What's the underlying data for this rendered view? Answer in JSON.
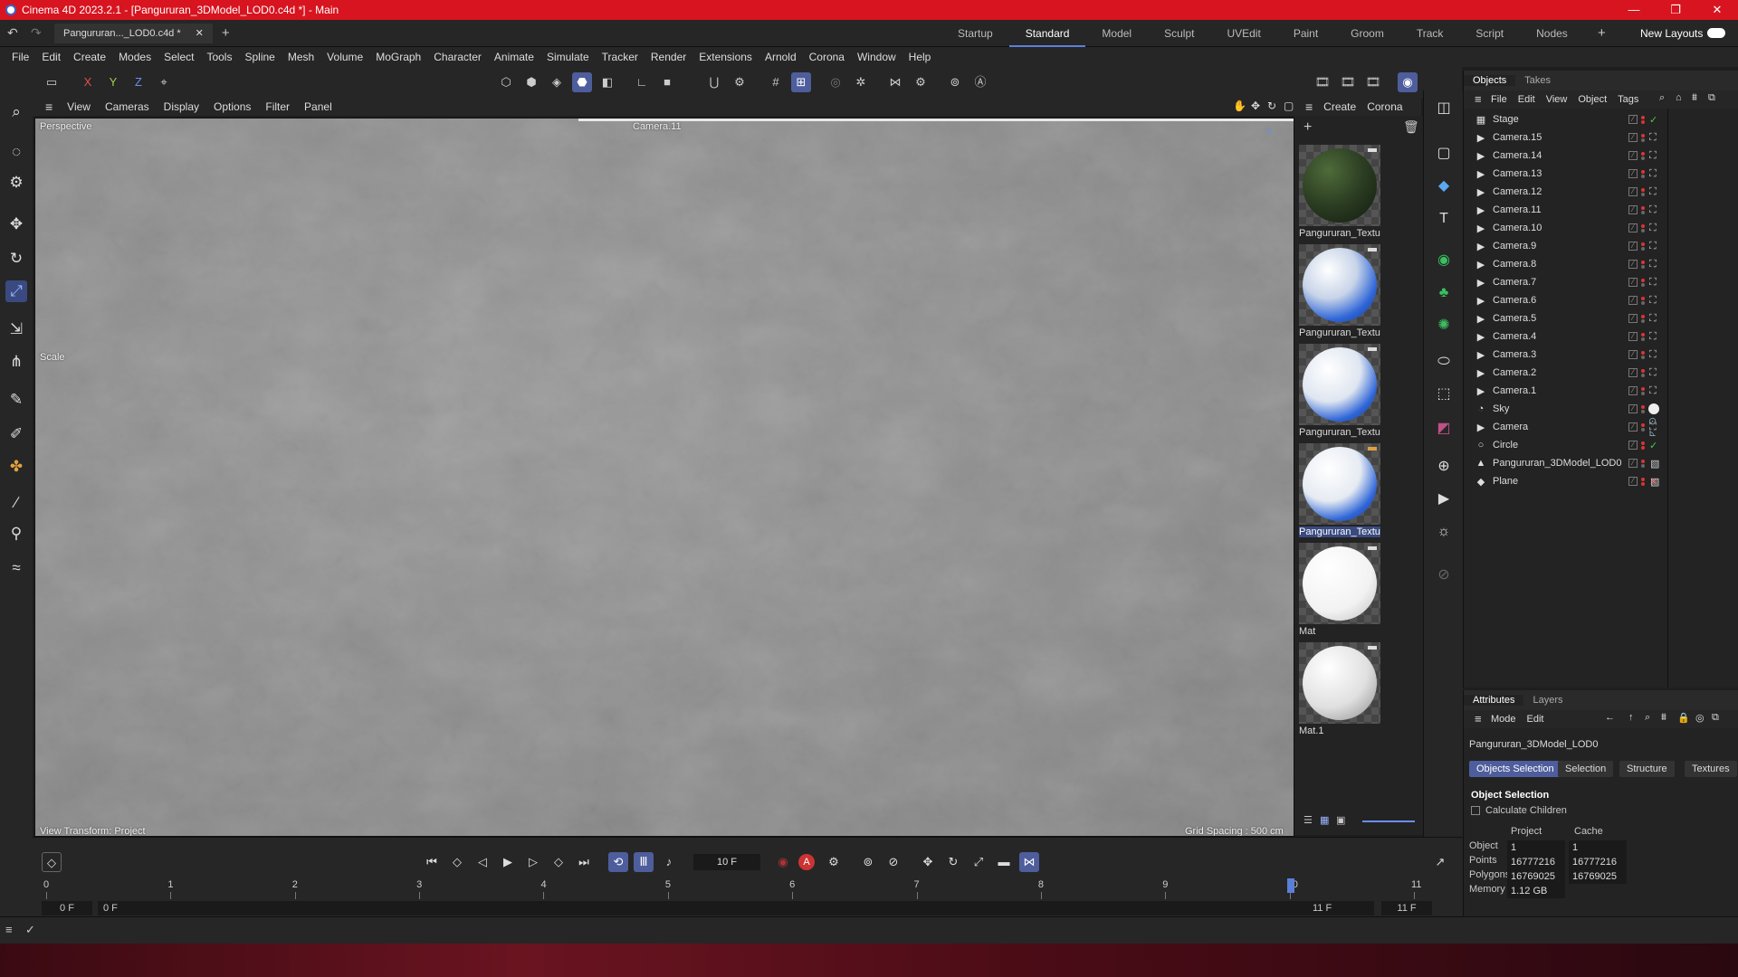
{
  "window": {
    "title": "Cinema 4D 2023.2.1 - [Pangururan_3DModel_LOD0.c4d *] - Main",
    "minimize": "—",
    "restore": "❐",
    "close": "✕"
  },
  "tabs": {
    "doc_tab": "Pangururan..._LOD0.c4d *",
    "doc_close": "✕",
    "add": "+",
    "layouts": [
      "Startup",
      "Standard",
      "Model",
      "Sculpt",
      "UVEdit",
      "Paint",
      "Groom",
      "Track",
      "Script",
      "Nodes"
    ],
    "active_layout": "Standard",
    "layout_add": "+",
    "new_layouts": "New Layouts"
  },
  "menu": [
    "File",
    "Edit",
    "Create",
    "Modes",
    "Select",
    "Tools",
    "Spline",
    "Mesh",
    "Volume",
    "MoGraph",
    "Character",
    "Animate",
    "Simulate",
    "Tracker",
    "Render",
    "Extensions",
    "Arnold",
    "Corona",
    "Window",
    "Help"
  ],
  "axis": {
    "x": "X",
    "y": "Y",
    "z": "Z"
  },
  "viewport": {
    "menu": [
      "View",
      "Cameras",
      "Display",
      "Options",
      "Filter",
      "Panel"
    ],
    "projection": "Perspective",
    "camera": "Camera.11",
    "tool_label": "Scale",
    "view_transform": "View Transform: Project",
    "grid_spacing": "Grid Spacing : 500 cm"
  },
  "materials": {
    "menu": [
      "Create",
      "Corona"
    ],
    "items": [
      {
        "name": "Pangururan_Textu",
        "kind": "terrain"
      },
      {
        "name": "Pangururan_Textu",
        "kind": "blue1"
      },
      {
        "name": "Pangururan_Textu",
        "kind": "blue2"
      },
      {
        "name": "Pangururan_Textu",
        "kind": "blue3",
        "selected": true
      },
      {
        "name": "Mat",
        "kind": "white"
      },
      {
        "name": "Mat.1",
        "kind": "white2"
      }
    ]
  },
  "objects": {
    "tabs": [
      "Objects",
      "Takes"
    ],
    "menu": [
      "File",
      "Edit",
      "View",
      "Object",
      "Tags"
    ],
    "items": [
      {
        "name": "Stage",
        "icon": "▦"
      },
      {
        "name": "Camera.15",
        "icon": "▶"
      },
      {
        "name": "Camera.14",
        "icon": "▶"
      },
      {
        "name": "Camera.13",
        "icon": "▶"
      },
      {
        "name": "Camera.12",
        "icon": "▶"
      },
      {
        "name": "Camera.11",
        "icon": "▶"
      },
      {
        "name": "Camera.10",
        "icon": "▶"
      },
      {
        "name": "Camera.9",
        "icon": "▶"
      },
      {
        "name": "Camera.8",
        "icon": "▶"
      },
      {
        "name": "Camera.7",
        "icon": "▶"
      },
      {
        "name": "Camera.6",
        "icon": "▶"
      },
      {
        "name": "Camera.5",
        "icon": "▶"
      },
      {
        "name": "Camera.4",
        "icon": "▶"
      },
      {
        "name": "Camera.3",
        "icon": "▶"
      },
      {
        "name": "Camera.2",
        "icon": "▶"
      },
      {
        "name": "Camera.1",
        "icon": "▶"
      },
      {
        "name": "Sky",
        "icon": "◔"
      },
      {
        "name": "Camera",
        "icon": "▶"
      },
      {
        "name": "Circle",
        "icon": "○"
      },
      {
        "name": "Pangururan_3DModel_LOD0",
        "icon": "▲"
      },
      {
        "name": "Plane",
        "icon": "◆"
      }
    ]
  },
  "attributes": {
    "tabs": [
      "Attributes",
      "Layers"
    ],
    "menu": [
      "Mode",
      "Edit"
    ],
    "object_name": "Pangururan_3DModel_LOD0",
    "subtabs": [
      "Objects Selection",
      "Selection",
      "Structure",
      "Textures"
    ],
    "section": "Object Selection",
    "calc_children": "Calculate Children",
    "col_project": "Project",
    "col_cache": "Cache",
    "rows": [
      {
        "label": "Object",
        "project": "1",
        "cache": "1"
      },
      {
        "label": "Points",
        "project": "16777216",
        "cache": "16777216"
      },
      {
        "label": "Polygons",
        "project": "16769025",
        "cache": "16769025"
      },
      {
        "label": "Memory",
        "project": "1.12 GB",
        "cache": ""
      }
    ]
  },
  "timeline": {
    "current_frame": "10 F",
    "ticks": [
      "0",
      "1",
      "2",
      "3",
      "4",
      "5",
      "6",
      "7",
      "8",
      "9",
      "10",
      "11"
    ],
    "start": "0 F",
    "range_start": "0 F",
    "range_end": "11 F",
    "end": "11 F"
  }
}
